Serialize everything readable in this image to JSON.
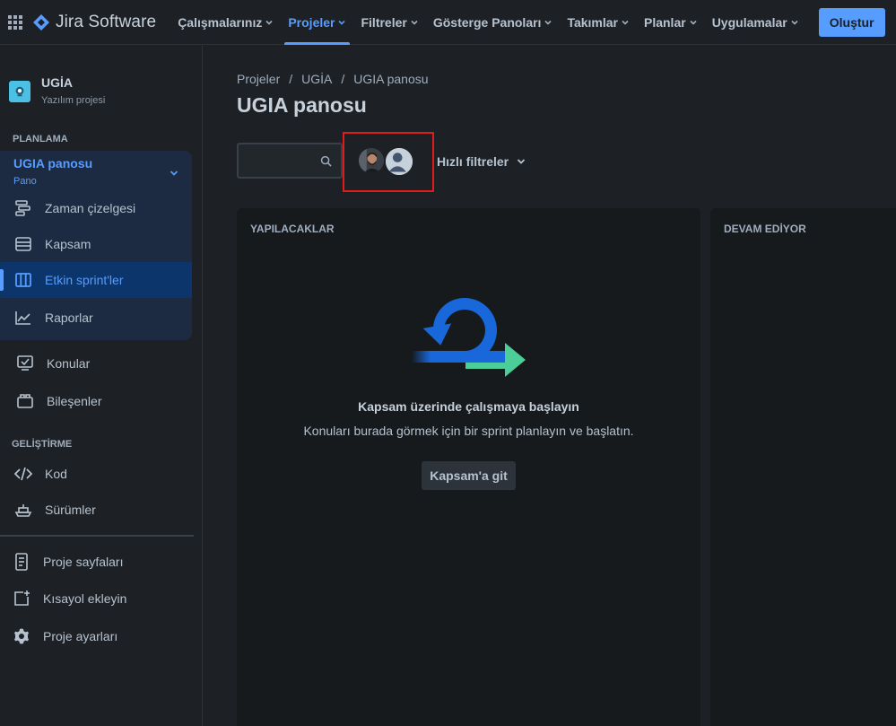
{
  "app": {
    "title": "Jira Software"
  },
  "topnav": {
    "items": [
      {
        "label": "Çalışmalarınız"
      },
      {
        "label": "Projeler"
      },
      {
        "label": "Filtreler"
      },
      {
        "label": "Gösterge Panoları"
      },
      {
        "label": "Takımlar"
      },
      {
        "label": "Planlar"
      },
      {
        "label": "Uygulamalar"
      }
    ],
    "active_index": 1,
    "create_label": "Oluştur"
  },
  "sidebar": {
    "project_name": "UGİA",
    "project_type": "Yazılım projesi",
    "planning_header": "PLANLAMA",
    "board_name": "UGIA panosu",
    "board_type": "Pano",
    "planning_items": [
      {
        "label": "Zaman çizelgesi",
        "icon": "timeline-icon"
      },
      {
        "label": "Kapsam",
        "icon": "backlog-icon"
      },
      {
        "label": "Etkin sprint'ler",
        "icon": "board-icon"
      },
      {
        "label": "Raporlar",
        "icon": "reports-icon"
      }
    ],
    "active_item": "Etkin sprint'ler",
    "other_items": [
      {
        "label": "Konular",
        "icon": "issues-icon"
      },
      {
        "label": "Bileşenler",
        "icon": "components-icon"
      }
    ],
    "dev_header": "GELİŞTİRME",
    "dev_items": [
      {
        "label": "Kod",
        "icon": "code-icon"
      },
      {
        "label": "Sürümler",
        "icon": "releases-icon"
      }
    ],
    "bottom_items": [
      {
        "label": "Proje sayfaları",
        "icon": "page-icon"
      },
      {
        "label": "Kısayol ekleyin",
        "icon": "add-shortcut-icon"
      },
      {
        "label": "Proje ayarları",
        "icon": "settings-icon"
      }
    ]
  },
  "main": {
    "breadcrumb": [
      "Projeler",
      "UGİA",
      "UGIA panosu"
    ],
    "title": "UGIA panosu",
    "search_placeholder": "",
    "quick_filters_label": "Hızlı filtreler",
    "columns": [
      {
        "title": "YAPILACAKLAR"
      },
      {
        "title": "DEVAM EDİYOR"
      }
    ],
    "empty_state": {
      "title": "Kapsam üzerinde çalışmaya başlayın",
      "description": "Konuları burada görmek için bir sprint planlayın ve başlatın.",
      "button_label": "Kapsam'a git"
    }
  },
  "colors": {
    "accent": "#579dff",
    "background": "#1d2125",
    "column_bg": "#161a1d",
    "highlight_box": "#e11b1b"
  }
}
